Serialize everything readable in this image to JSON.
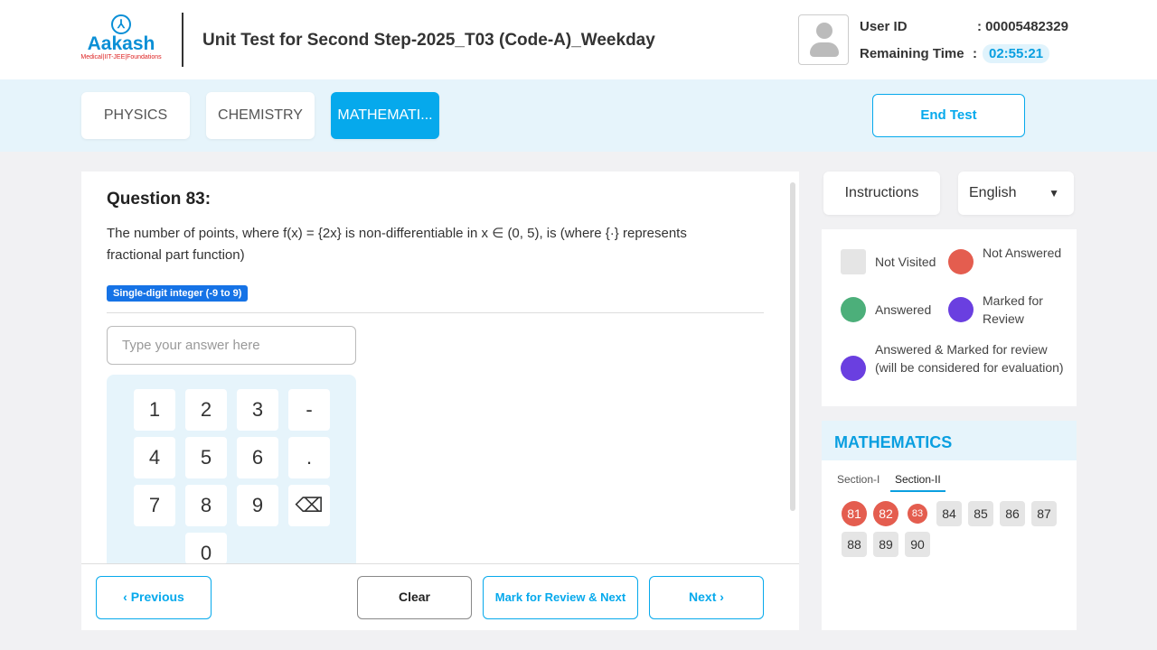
{
  "header": {
    "logo_text": "Aakash",
    "logo_sub": "Medical|IIT-JEE|Foundations",
    "title": "Unit Test for Second Step-2025_T03 (Code-A)_Weekday",
    "user_id_label": "User ID",
    "user_id": ": 00005482329",
    "remaining_label": "Remaining Time",
    "remaining_colon": ":",
    "remaining_time": "02:55:21"
  },
  "tabs": [
    {
      "label": "PHYSICS"
    },
    {
      "label": "CHEMISTRY"
    },
    {
      "label": "MATHEMATI..."
    }
  ],
  "end_test": "End Test",
  "question": {
    "title": "Question 83:",
    "text": "The number of points, where f(x) = {2x} is non-differentiable in x ∈ (0, 5), is (where {·} represents fractional part function)",
    "type_badge": "Single-digit integer (-9 to 9)",
    "answer_placeholder": "Type your answer here",
    "keys": [
      "1",
      "2",
      "3",
      "-",
      "4",
      "5",
      "6",
      ".",
      "7",
      "8",
      "9",
      "⌫",
      "0"
    ]
  },
  "footer": {
    "previous": "Previous",
    "clear": "Clear",
    "mark_review": "Mark for Review & Next",
    "next": "Next"
  },
  "sidebar": {
    "instructions": "Instructions",
    "language": "English",
    "legend": {
      "not_visited": "Not Visited",
      "not_answered": "Not Answered",
      "answered": "Answered",
      "marked": "Marked for Review",
      "answered_marked": "Answered & Marked for review (will be considered for evaluation)"
    },
    "colors": {
      "not_visited": "#e5e5e5",
      "not_answered": "#e45d4f",
      "answered": "#4caf7a",
      "marked": "#6a3fe0"
    },
    "subject": "MATHEMATICS",
    "sections": [
      "Section-I",
      "Section-II"
    ],
    "active_section": "Section-II",
    "questions": [
      {
        "n": "81",
        "status": "not_answered"
      },
      {
        "n": "82",
        "status": "not_answered"
      },
      {
        "n": "83",
        "status": "not_answered"
      },
      {
        "n": "84",
        "status": "not_visited"
      },
      {
        "n": "85",
        "status": "not_visited"
      },
      {
        "n": "86",
        "status": "not_visited"
      },
      {
        "n": "87",
        "status": "not_visited"
      },
      {
        "n": "88",
        "status": "not_visited"
      },
      {
        "n": "89",
        "status": "not_visited"
      },
      {
        "n": "90",
        "status": "not_visited"
      }
    ]
  }
}
